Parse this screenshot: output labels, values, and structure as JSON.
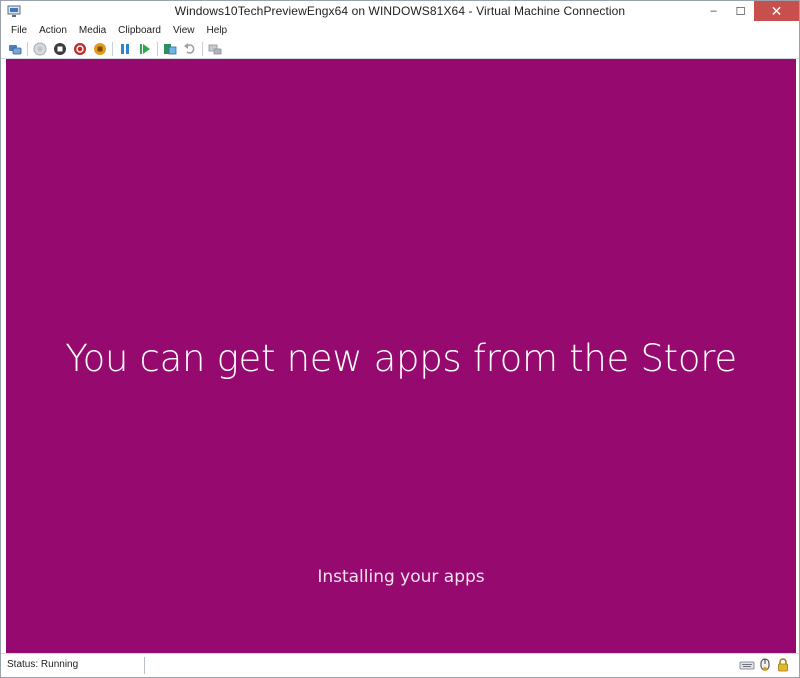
{
  "window": {
    "title": "Windows10TechPreviewEngx64 on WINDOWS81X64 - Virtual Machine Connection",
    "caption": {
      "minimize": "–",
      "maximize": "☐",
      "close": "✕"
    }
  },
  "menu": {
    "items": [
      "File",
      "Action",
      "Media",
      "Clipboard",
      "View",
      "Help"
    ]
  },
  "toolbar": {
    "buttons": [
      "ctrl-alt-del-icon",
      "start-icon",
      "turn-off-icon",
      "shut-down-icon",
      "save-icon",
      "pause-icon",
      "resume-icon",
      "checkpoint-icon",
      "revert-icon",
      "enhanced-session-icon"
    ]
  },
  "screen": {
    "headline": "You can get new apps from the Store",
    "subline": "Installing your apps",
    "background": "#960a70"
  },
  "status": {
    "text": "Status: Running",
    "icons": [
      "keyboard-icon",
      "mouse-capture-icon",
      "lock-icon"
    ]
  },
  "colors": {
    "close_button": "#c7504c",
    "vm_background": "#960a70"
  }
}
